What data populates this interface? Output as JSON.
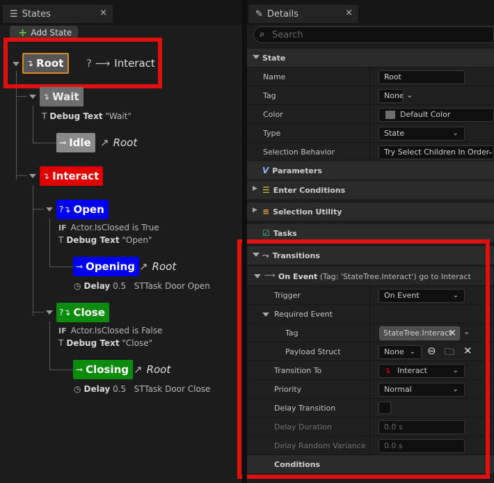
{
  "states_panel": {
    "tab_title": "States",
    "close": "×",
    "add_state": "Add State",
    "nodes": {
      "root": {
        "label": "Root",
        "transition_prefix": "?",
        "transition_target": "Interact"
      },
      "wait": {
        "label": "Wait",
        "task_keyword": "Debug Text",
        "task_value": "\"Wait\""
      },
      "idle": {
        "label": "Idle",
        "transition_target": "Root"
      },
      "interact": {
        "label": "Interact"
      },
      "open": {
        "label": "Open",
        "cond_if": "IF",
        "cond_text": "Actor.IsClosed is True",
        "task_keyword": "Debug Text",
        "task_value": "\"Open\""
      },
      "opening": {
        "label": "Opening",
        "transition_target": "Root",
        "task_keyword": "Delay",
        "task_value": "0.5",
        "task_name": "STTask Door Open"
      },
      "close": {
        "label": "Close",
        "cond_if": "IF",
        "cond_text": "Actor.IsClosed is False",
        "task_keyword": "Debug Text",
        "task_value": "\"Close\""
      },
      "closing": {
        "label": "Closing",
        "transition_target": "Root",
        "task_keyword": "Delay",
        "task_value": "0.5",
        "task_name": "STTask Door Close"
      }
    },
    "colors": {
      "root": "#555555",
      "wait": "#6e6e6e",
      "idle": "#8a8a8a",
      "interact": "#e00000",
      "open": "#0000f0",
      "close": "#0c8c0c"
    }
  },
  "details_panel": {
    "tab_title": "Details",
    "close": "×",
    "search_placeholder": "Search",
    "state_section": "State",
    "name_label": "Name",
    "name_value": "Root",
    "tag_label": "Tag",
    "tag_value": "None",
    "color_label": "Color",
    "color_value": "Default Color",
    "type_label": "Type",
    "type_value": "State",
    "selection_label": "Selection Behavior",
    "selection_value": "Try Select Children In Order",
    "parameters": "Parameters",
    "enter_conditions": "Enter Conditions",
    "selection_utility": "Selection Utility",
    "tasks": "Tasks",
    "transitions": "Transitions",
    "on_event_title": "On Event",
    "on_event_detail": "(Tag: 'StateTree.Interact') go to Interact",
    "trigger_label": "Trigger",
    "trigger_value": "On Event",
    "required_event_label": "Required Event",
    "req_tag_label": "Tag",
    "req_tag_value": "StateTree.Interact",
    "payload_label": "Payload Struct",
    "payload_value": "None",
    "transition_to_label": "Transition To",
    "transition_to_value": "Interact",
    "priority_label": "Priority",
    "priority_value": "Normal",
    "delay_transition_label": "Delay Transition",
    "delay_duration_label": "Delay Duration",
    "delay_duration_value": "0.0 s",
    "delay_random_label": "Delay Random Variance",
    "delay_random_value": "0.0 s",
    "conditions_label": "Conditions"
  }
}
